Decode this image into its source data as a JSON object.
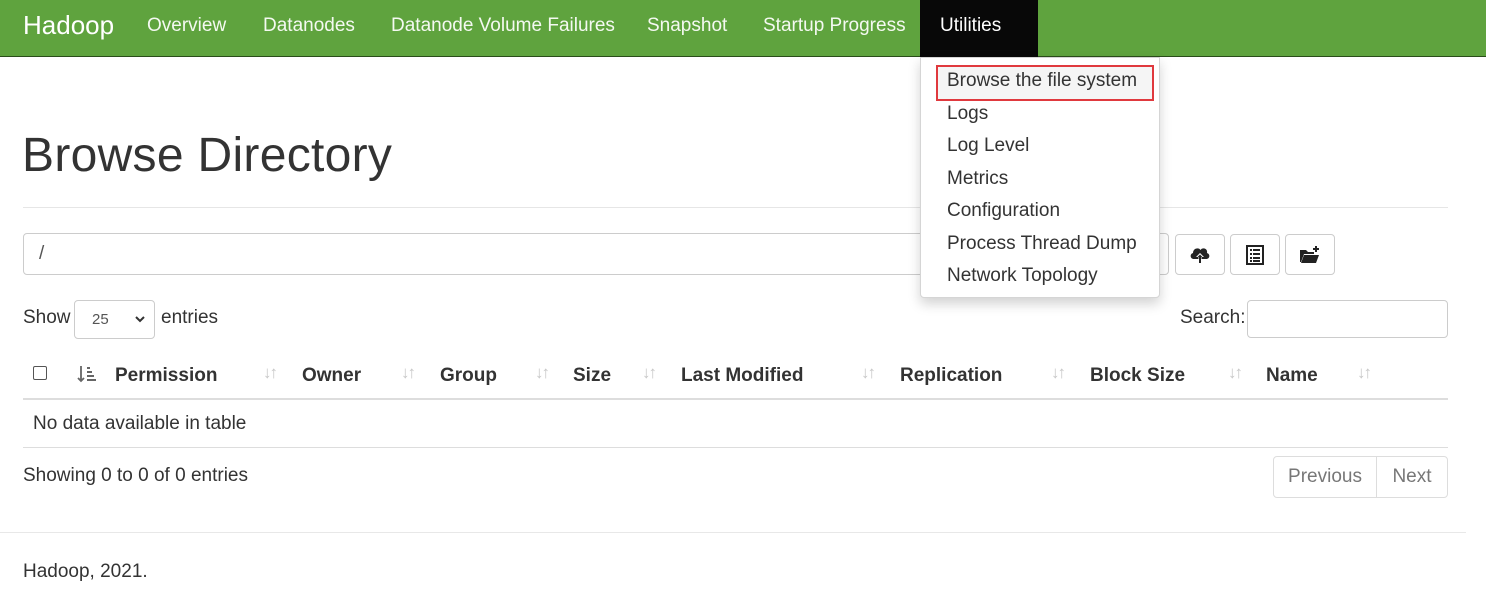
{
  "navbar": {
    "brand": "Hadoop",
    "items": [
      "Overview",
      "Datanodes",
      "Datanode Volume Failures",
      "Snapshot",
      "Startup Progress",
      "Utilities"
    ],
    "active": "Utilities",
    "color": "#5fa33e"
  },
  "dropdown": {
    "items": [
      "Browse the file system",
      "Logs",
      "Log Level",
      "Metrics",
      "Configuration",
      "Process Thread Dump",
      "Network Topology"
    ],
    "highlighted": "Browse the file system",
    "highlight_color": "#e0393e"
  },
  "page": {
    "title": "Browse Directory",
    "path": "/"
  },
  "toolbar": {
    "icons": [
      "upload-icon",
      "file-list-icon",
      "new-folder-icon"
    ]
  },
  "table_controls": {
    "show_label": "Show",
    "page_size": "25",
    "entries_label": "entries",
    "search_label": "Search:"
  },
  "table": {
    "columns": [
      "Permission",
      "Owner",
      "Group",
      "Size",
      "Last Modified",
      "Replication",
      "Block Size",
      "Name"
    ],
    "empty_message": "No data available in table"
  },
  "pagination": {
    "info": "Showing 0 to 0 of 0 entries",
    "previous": "Previous",
    "next": "Next"
  },
  "footer": {
    "text": "Hadoop, 2021."
  }
}
